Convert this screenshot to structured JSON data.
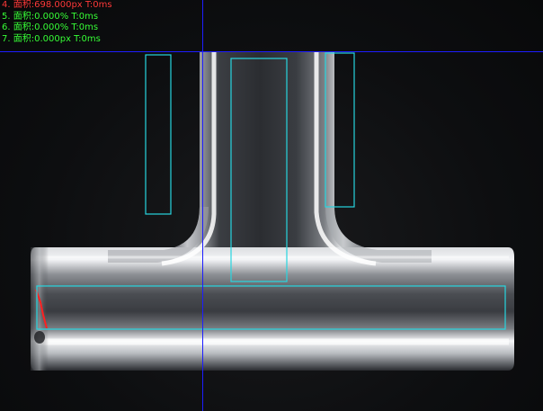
{
  "overlay": {
    "lines": [
      {
        "text": "4. 面积:698.000px  T:0ms",
        "color": "#ff3b3b"
      },
      {
        "text": "5. 面积:0.000%  T:0ms",
        "color": "#39ff39"
      },
      {
        "text": "6. 面积:0.000%  T:0ms",
        "color": "#39ff39"
      },
      {
        "text": "7. 面积:0.000px  T:0ms",
        "color": "#39ff39"
      }
    ]
  },
  "colors": {
    "roi": "#27d6e0",
    "crosshair": "#1d1dff",
    "defect": "#ff2020",
    "metal_highlight": "#f2f3f5",
    "metal_mid": "#7b7e83",
    "metal_dark": "#2a2c30"
  }
}
